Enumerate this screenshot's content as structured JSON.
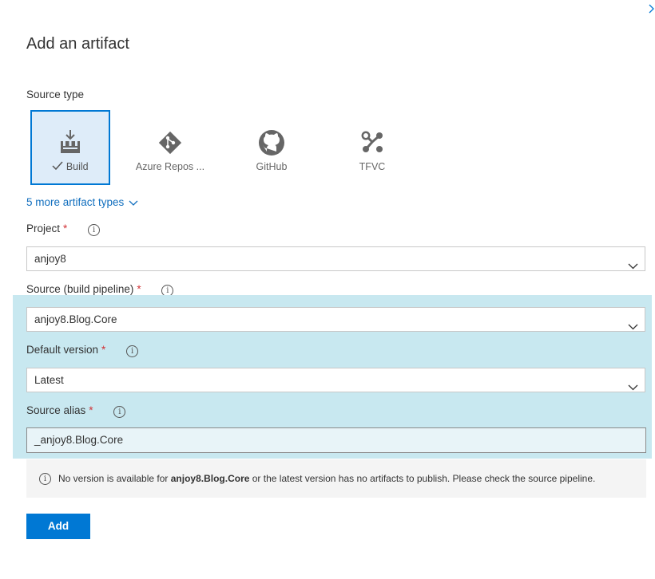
{
  "panel": {
    "title": "Add an artifact",
    "expand_icon": "chevron-right"
  },
  "source_type": {
    "label": "Source type",
    "tiles": [
      {
        "label": "Build",
        "icon": "build-pipeline-icon",
        "selected": true
      },
      {
        "label": "Azure Repos ...",
        "icon": "git-diamond-icon",
        "selected": false
      },
      {
        "label": "GitHub",
        "icon": "github-icon",
        "selected": false
      },
      {
        "label": "TFVC",
        "icon": "tfvc-icon",
        "selected": false
      }
    ],
    "more_link": "5 more artifact types"
  },
  "project": {
    "label": "Project",
    "required_mark": "*",
    "value": "anjoy8"
  },
  "source": {
    "label": "Source (build pipeline)",
    "required_mark": "*",
    "value": "anjoy8.Blog.Core"
  },
  "default_version": {
    "label": "Default version",
    "required_mark": "*",
    "value": "Latest"
  },
  "source_alias": {
    "label": "Source alias",
    "required_mark": "*",
    "value": "_anjoy8.Blog.Core"
  },
  "message": {
    "prefix": "No version is available for ",
    "bold": "anjoy8.Blog.Core",
    "suffix": " or the latest version has no artifacts to publish. Please check the source pipeline."
  },
  "add_button": "Add",
  "colors": {
    "accent": "#0078d4",
    "selected_tile_bg": "#deecf9",
    "highlight_bg": "#c8e8f0",
    "required": "#d13438"
  }
}
